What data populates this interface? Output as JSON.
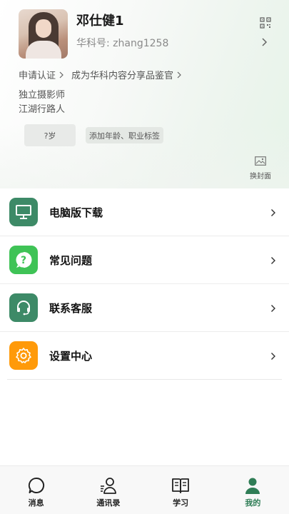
{
  "profile": {
    "name": "邓仕健1",
    "account": "华科号: zhang1258",
    "cert_apply": "申请认证",
    "cert_become": "成为华科内容分享品鉴官",
    "bio_line1": "独立摄影师",
    "bio_line2": "江湖行路人",
    "age_chip": "?岁",
    "tag_chip": "添加年龄、职业标签",
    "change_cover": "换封面"
  },
  "menu": [
    {
      "label": "电脑版下载",
      "icon": "monitor-icon",
      "color": "#3d8a67"
    },
    {
      "label": "常见问题",
      "icon": "question-icon",
      "color": "#3fc356"
    },
    {
      "label": "联系客服",
      "icon": "headset-icon",
      "color": "#3d8a67"
    },
    {
      "label": "设置中心",
      "icon": "gear-icon",
      "color": "#ff9a0a"
    }
  ],
  "tabbar": [
    {
      "label": "消息",
      "icon": "chat-bubble-icon",
      "active": false
    },
    {
      "label": "通讯录",
      "icon": "contacts-icon",
      "active": false
    },
    {
      "label": "学习",
      "icon": "book-icon",
      "active": false
    },
    {
      "label": "我的",
      "icon": "person-icon",
      "active": true
    }
  ],
  "colors": {
    "accent": "#2f7d56"
  }
}
